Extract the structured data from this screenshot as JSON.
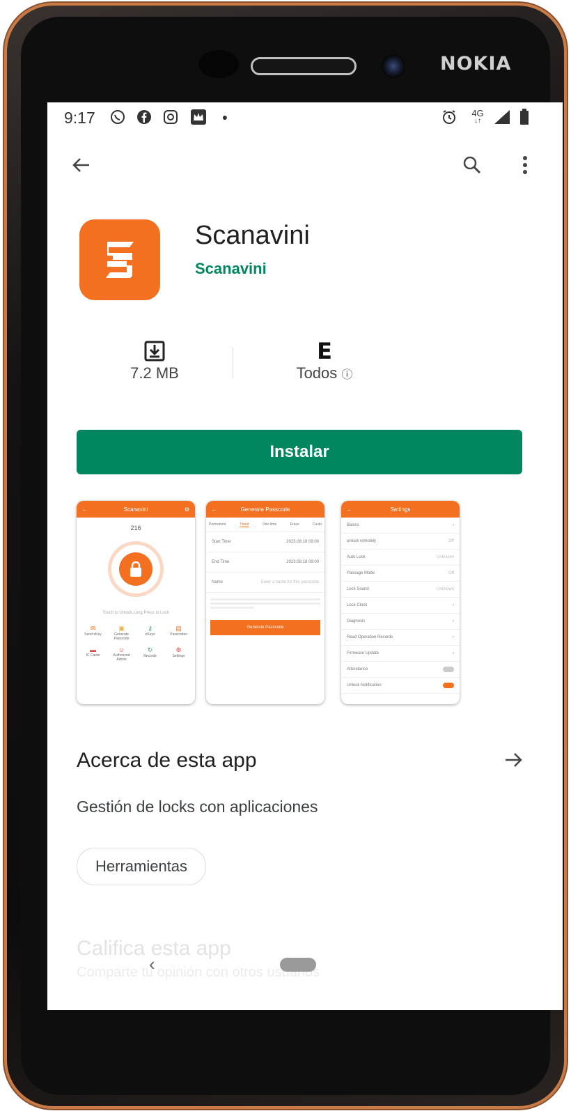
{
  "device": {
    "brand": "NOKIA"
  },
  "status_bar": {
    "time": "9:17",
    "left_icons": [
      "whatsapp-icon",
      "facebook-icon",
      "instagram-icon",
      "crown-app-icon",
      "dot"
    ],
    "network": "4G"
  },
  "app": {
    "name": "Scanavini",
    "developer": "Scanavini",
    "icon_color": "#f37021",
    "size": "7.2 MB",
    "rating_badge": "E",
    "rating_label": "Todos",
    "install_label": "Instalar",
    "install_color": "#01875f"
  },
  "screenshots": [
    {
      "title": "Scanavini",
      "code": "216",
      "hint": "Touch to Unlock,Long Press to Lock",
      "grid": [
        "Send eKey",
        "Generate Passcode",
        "eKeys",
        "Passcodes",
        "IC Cards",
        "Authorized Admin",
        "Records",
        "Settings"
      ]
    },
    {
      "title": "Generate Passcode",
      "tabs": [
        "Permanent",
        "Timed",
        "One-time",
        "Erase",
        "Custo"
      ],
      "rows": [
        {
          "label": "Start Time",
          "value": "2023.08.18 09:00"
        },
        {
          "label": "End Time",
          "value": "2023.08.18 09:00"
        },
        {
          "label": "Name",
          "value": "Enter a name for this passcode"
        }
      ],
      "button": "Generate Passcode"
    },
    {
      "title": "Settings",
      "rows": [
        {
          "label": "Basics",
          "value": ""
        },
        {
          "label": "unlock remotely",
          "value": "Off"
        },
        {
          "label": "Auto Lock",
          "value": "Unknown"
        },
        {
          "label": "Passage Mode",
          "value": "Off"
        },
        {
          "label": "Lock Sound",
          "value": "Unknown"
        },
        {
          "label": "Lock Clock",
          "value": ""
        },
        {
          "label": "Diagnosis",
          "value": ""
        },
        {
          "label": "Read Operation Records",
          "value": ""
        },
        {
          "label": "Firmware Update",
          "value": ""
        },
        {
          "label": "Attendance",
          "value": ""
        },
        {
          "label": "Unlock Notification",
          "value": ""
        }
      ]
    }
  ],
  "about": {
    "title": "Acerca de esta app",
    "description": "Gestión de locks con aplicaciones",
    "chip": "Herramientas"
  },
  "rate": {
    "title": "Califica esta app",
    "subtitle": "Comparte tu opinión con otros usuarios"
  }
}
